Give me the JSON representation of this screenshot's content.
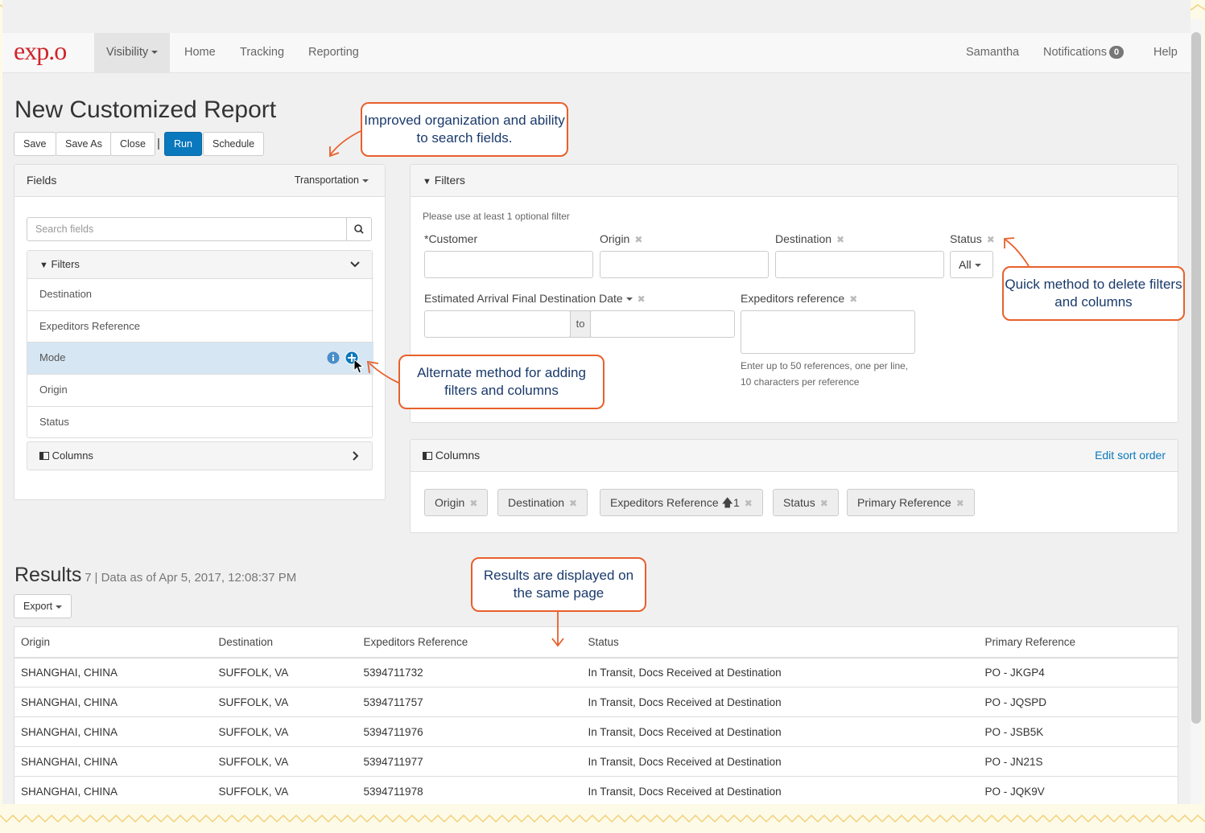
{
  "nav": {
    "logo": "exp.o",
    "active": "Visibility",
    "items": [
      "Home",
      "Tracking",
      "Reporting"
    ],
    "user": "Samantha",
    "notifications_label": "Notifications",
    "notifications_count": "0",
    "help": "Help"
  },
  "page": {
    "title": "New Customized Report",
    "buttons": {
      "save": "Save",
      "save_as": "Save As",
      "close": "Close",
      "separator": "|",
      "run": "Run",
      "schedule": "Schedule"
    }
  },
  "fields_panel": {
    "title": "Fields",
    "category": "Transportation",
    "search_placeholder": "Search fields",
    "filters_label": "Filters",
    "items": [
      "Destination",
      "Expeditors Reference",
      "Mode",
      "Origin",
      "Status"
    ],
    "columns_label": "Columns"
  },
  "filters_panel": {
    "title": "Filters",
    "hint": "Please use at least 1 optional filter",
    "customer_label": "*Customer",
    "origin_label": "Origin",
    "destination_label": "Destination",
    "status_label": "Status",
    "status_value": "All",
    "date_label": "Estimated Arrival Final Destination Date",
    "date_to": "to",
    "ref_label": "Expeditors reference",
    "ref_help_1": "Enter up to 50 references, one per line,",
    "ref_help_2": "10 characters per reference"
  },
  "columns_panel": {
    "title": "Columns",
    "edit_sort": "Edit sort order",
    "tags": [
      "Origin",
      "Destination",
      "Expeditors Reference",
      "Status",
      "Primary Reference"
    ],
    "sort_suffix": "1"
  },
  "results": {
    "title": "Results",
    "count": "7",
    "as_of": "| Data as of Apr 5, 2017, 12:08:37 PM",
    "export": "Export",
    "headers": [
      "Origin",
      "Destination",
      "Expeditors Reference",
      "Status",
      "Primary Reference"
    ],
    "rows": [
      [
        "SHANGHAI, CHINA",
        "SUFFOLK, VA",
        "5394711732",
        "In Transit, Docs Received at Destination",
        "PO - JKGP4"
      ],
      [
        "SHANGHAI, CHINA",
        "SUFFOLK, VA",
        "5394711757",
        "In Transit, Docs Received at Destination",
        "PO - JQSPD"
      ],
      [
        "SHANGHAI, CHINA",
        "SUFFOLK, VA",
        "5394711976",
        "In Transit, Docs Received at Destination",
        "PO - JSB5K"
      ],
      [
        "SHANGHAI, CHINA",
        "SUFFOLK, VA",
        "5394711977",
        "In Transit, Docs Received at Destination",
        "PO - JN21S"
      ],
      [
        "SHANGHAI, CHINA",
        "SUFFOLK, VA",
        "5394711978",
        "In Transit, Docs Received at Destination",
        "PO - JQK9V"
      ]
    ]
  },
  "callouts": {
    "organization": "Improved organization and ability to search fields.",
    "delete": "Quick method to delete filters and columns",
    "alternate": "Alternate method for adding filters and columns",
    "results": "Results are displayed on the same page"
  },
  "colors": {
    "accent": "#0a78bd",
    "callout_border": "#e8602c",
    "callout_text": "#1a3a6b",
    "logo": "#d0232a"
  }
}
